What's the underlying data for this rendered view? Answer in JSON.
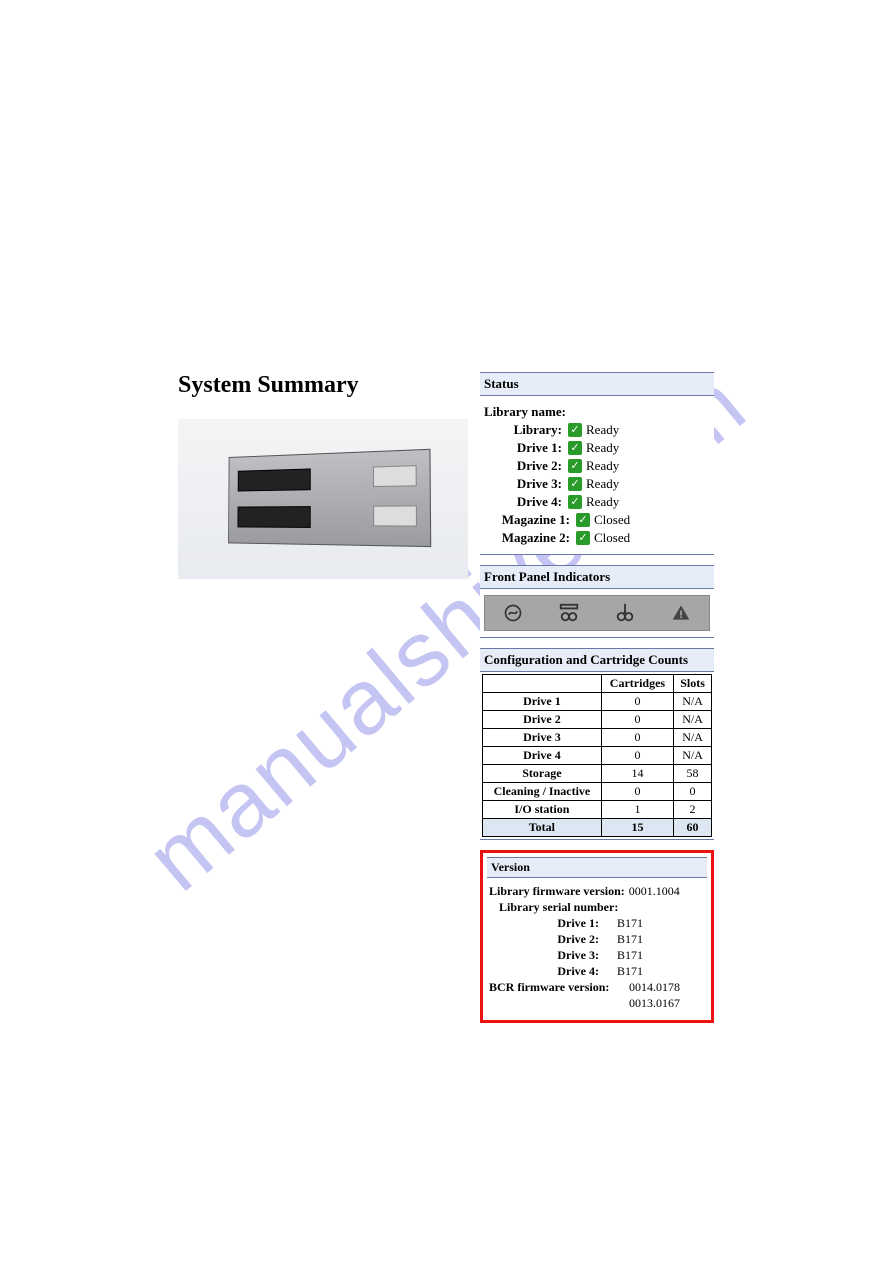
{
  "watermark": "manualshive.com",
  "title": "System Summary",
  "status": {
    "header": "Status",
    "library_name_label": "Library name:",
    "items": [
      {
        "label": "Library:",
        "state": "Ready"
      },
      {
        "label": "Drive 1:",
        "state": "Ready"
      },
      {
        "label": "Drive 2:",
        "state": "Ready"
      },
      {
        "label": "Drive 3:",
        "state": "Ready"
      },
      {
        "label": "Drive 4:",
        "state": "Ready"
      },
      {
        "label": "Magazine 1:",
        "state": "Closed"
      },
      {
        "label": "Magazine 2:",
        "state": "Closed"
      }
    ]
  },
  "front_panel": {
    "header": "Front Panel Indicators",
    "icons": [
      "power-icon",
      "tape-icon",
      "activity-icon",
      "warning-icon"
    ]
  },
  "config": {
    "header": "Configuration and Cartridge Counts",
    "columns": [
      "",
      "Cartridges",
      "Slots"
    ],
    "rows": [
      {
        "name": "Drive 1",
        "cartridges": "0",
        "slots": "N/A"
      },
      {
        "name": "Drive 2",
        "cartridges": "0",
        "slots": "N/A"
      },
      {
        "name": "Drive 3",
        "cartridges": "0",
        "slots": "N/A"
      },
      {
        "name": "Drive 4",
        "cartridges": "0",
        "slots": "N/A"
      },
      {
        "name": "Storage",
        "cartridges": "14",
        "slots": "58"
      },
      {
        "name": "Cleaning / Inactive",
        "cartridges": "0",
        "slots": "0"
      },
      {
        "name": "I/O station",
        "cartridges": "1",
        "slots": "2"
      }
    ],
    "total": {
      "name": "Total",
      "cartridges": "15",
      "slots": "60"
    }
  },
  "version": {
    "header": "Version",
    "lib_fw_label": "Library firmware version:",
    "lib_fw_value": "0001.1004",
    "lib_serial_label": "Library serial number:",
    "drives": [
      {
        "label": "Drive 1:",
        "value": "B171"
      },
      {
        "label": "Drive 2:",
        "value": "B171"
      },
      {
        "label": "Drive 3:",
        "value": "B171"
      },
      {
        "label": "Drive 4:",
        "value": "B171"
      }
    ],
    "bcr_label": "BCR firmware version:",
    "bcr_values": [
      "0014.0178",
      "0013.0167"
    ]
  }
}
